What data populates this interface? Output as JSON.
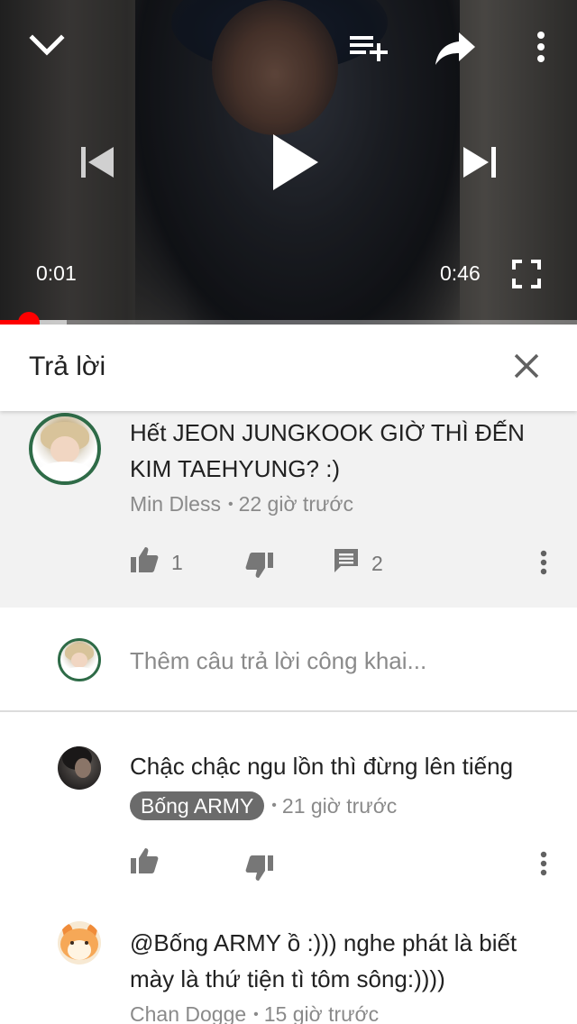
{
  "player": {
    "current_time": "0:01",
    "duration": "0:46",
    "progress_fraction": 0.05,
    "buffered_fraction": 0.115,
    "accent_color": "#ff0000"
  },
  "reply_panel": {
    "title": "Trả lời"
  },
  "parent_comment": {
    "text": "Hết JEON JUNGKOOK GIỜ THÌ ĐẾN KIM TAEHYUNG? :)",
    "author": "Min Dless",
    "separator": "•",
    "time": "22 giờ trước",
    "like_count": "1",
    "reply_count": "2"
  },
  "add_reply": {
    "placeholder": "Thêm câu trả lời công khai..."
  },
  "replies": [
    {
      "text": "Chậc chậc ngu lồn thì đừng lên tiếng",
      "author": "Bống ARMY",
      "author_is_badge": true,
      "separator": "•",
      "time": "21 giờ trước"
    },
    {
      "text": "@Bống ARMY  ồ :))) nghe phát là biết mày là thứ tiện tì tôm sông:))))",
      "author": "Chan Dogge",
      "separator": "•",
      "time": "15 giờ trước"
    }
  ],
  "icons": {
    "collapse": "chevron-down-icon",
    "add_to_queue": "playlist-add-icon",
    "share": "share-icon",
    "more": "more-vert-icon",
    "previous": "skip-previous-icon",
    "play": "play-icon",
    "next": "skip-next-icon",
    "fullscreen": "fullscreen-icon",
    "close": "close-icon",
    "like": "thumb-up-icon",
    "dislike": "thumb-down-icon",
    "reply": "comment-icon"
  }
}
